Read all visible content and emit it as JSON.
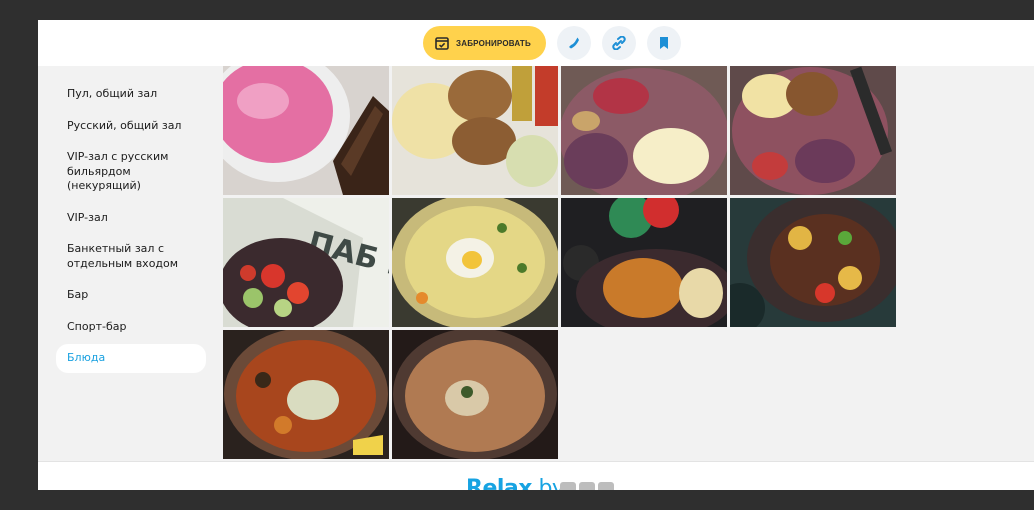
{
  "header": {
    "book_label": "ЗАБРОНИРОВАТЬ",
    "icons": [
      "calendar-check-icon",
      "phone-icon",
      "link-icon",
      "bookmark-icon"
    ]
  },
  "sidebar": {
    "items": [
      {
        "label": "Пул, общий зал"
      },
      {
        "label": "Русский, общий зал"
      },
      {
        "label": "VIP-зал с русским бильярдом (некурящий)"
      },
      {
        "label": "VIP-зал"
      },
      {
        "label": "Банкетный зал с отдельным входом"
      },
      {
        "label": "Бар"
      },
      {
        "label": "Спорт-бар"
      },
      {
        "label": "Блюда",
        "active": true
      }
    ]
  },
  "gallery": {
    "photos": [
      "beet-soup-with-bread",
      "cutlets-with-mashed-potatoes",
      "mashed-potatoes-with-cabbage-salad",
      "dumplings-with-cutlet-and-salad",
      "vegetable-salad",
      "chicken-noodle-soup-with-egg",
      "roasted-chicken-leg",
      "beef-stir-fry-with-vegetables",
      "solyanka-soup",
      "cream-soup"
    ]
  },
  "footer": {
    "logo_main": "Relax",
    "logo_tld": ".by",
    "socials": [
      "instagram-icon",
      "telegram-icon",
      "tiktok-icon"
    ]
  },
  "colors": {
    "accent": "#17a3e2",
    "book_button": "#ffd24c",
    "page_bg": "#f2f2f2",
    "outer_bg": "#2f2f2f"
  }
}
